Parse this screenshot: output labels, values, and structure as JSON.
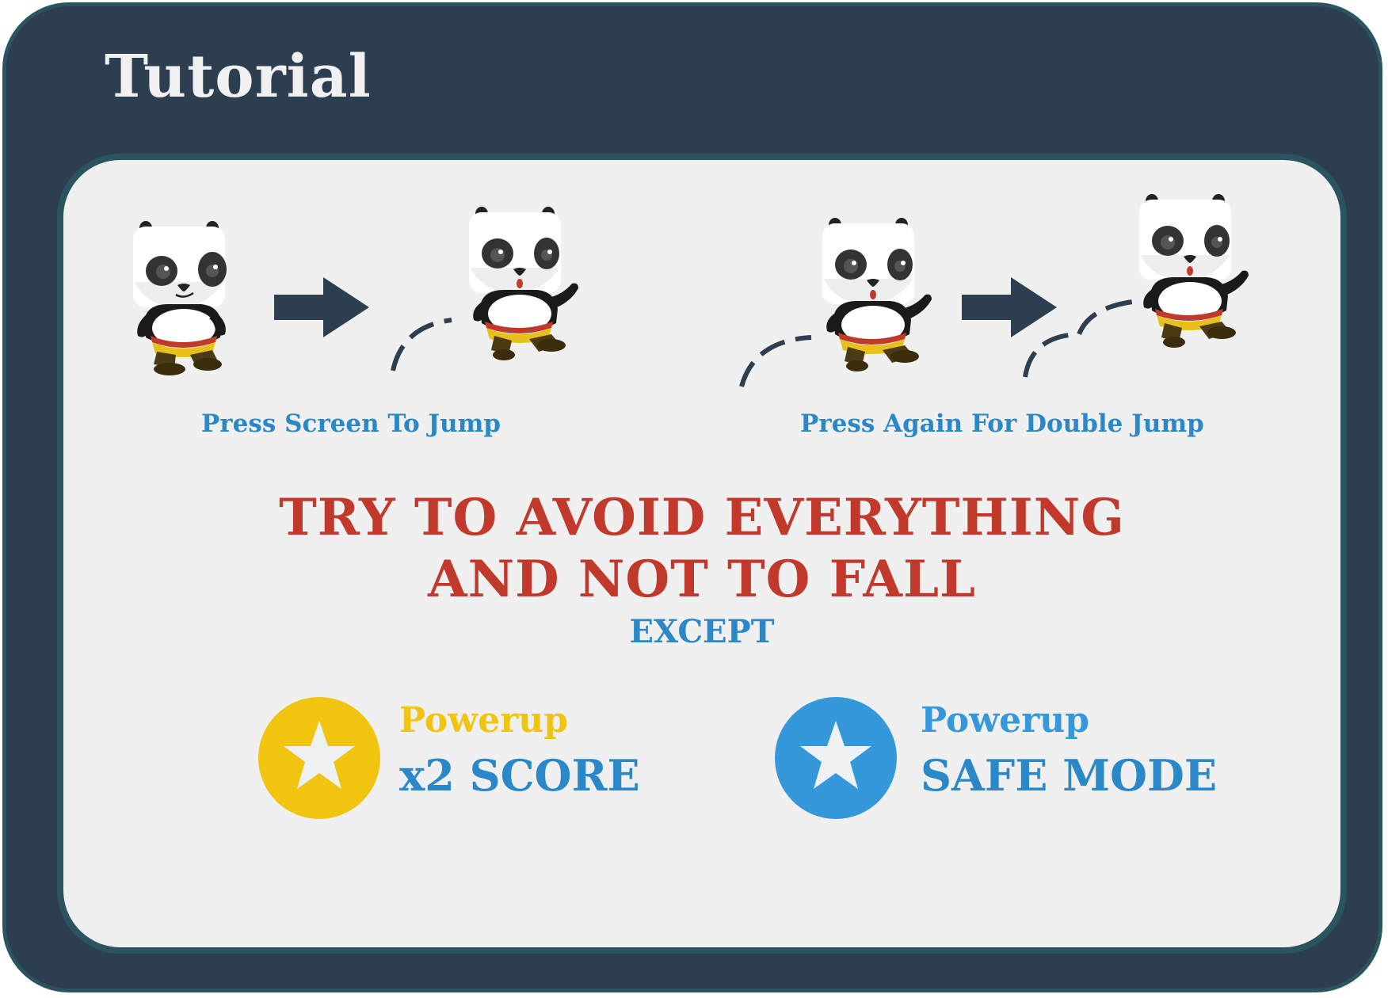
{
  "window": {
    "title": "Tutorial"
  },
  "tutorial": {
    "step1": {
      "caption": "Press Screen To Jump"
    },
    "step2": {
      "caption": "Press Again For Double Jump"
    },
    "warning": {
      "line1": "TRY TO AVOID EVERYTHING",
      "line2": "AND NOT TO FALL"
    },
    "except_label": "EXCEPT",
    "powerups": [
      {
        "label": "Powerup",
        "effect": "x2 SCORE",
        "icon": "star-icon",
        "color": "#f1c40f"
      },
      {
        "label": "Powerup",
        "effect": "SAFE MODE",
        "icon": "star-icon",
        "color": "#3498db"
      }
    ]
  },
  "colors": {
    "frame": "#2d3e50",
    "border": "#2a5560",
    "card": "#f0f0f0",
    "title": "#f1f1f1",
    "caption": "#2b88c8",
    "warning": "#c0392b",
    "arrow": "#2d3e50"
  }
}
